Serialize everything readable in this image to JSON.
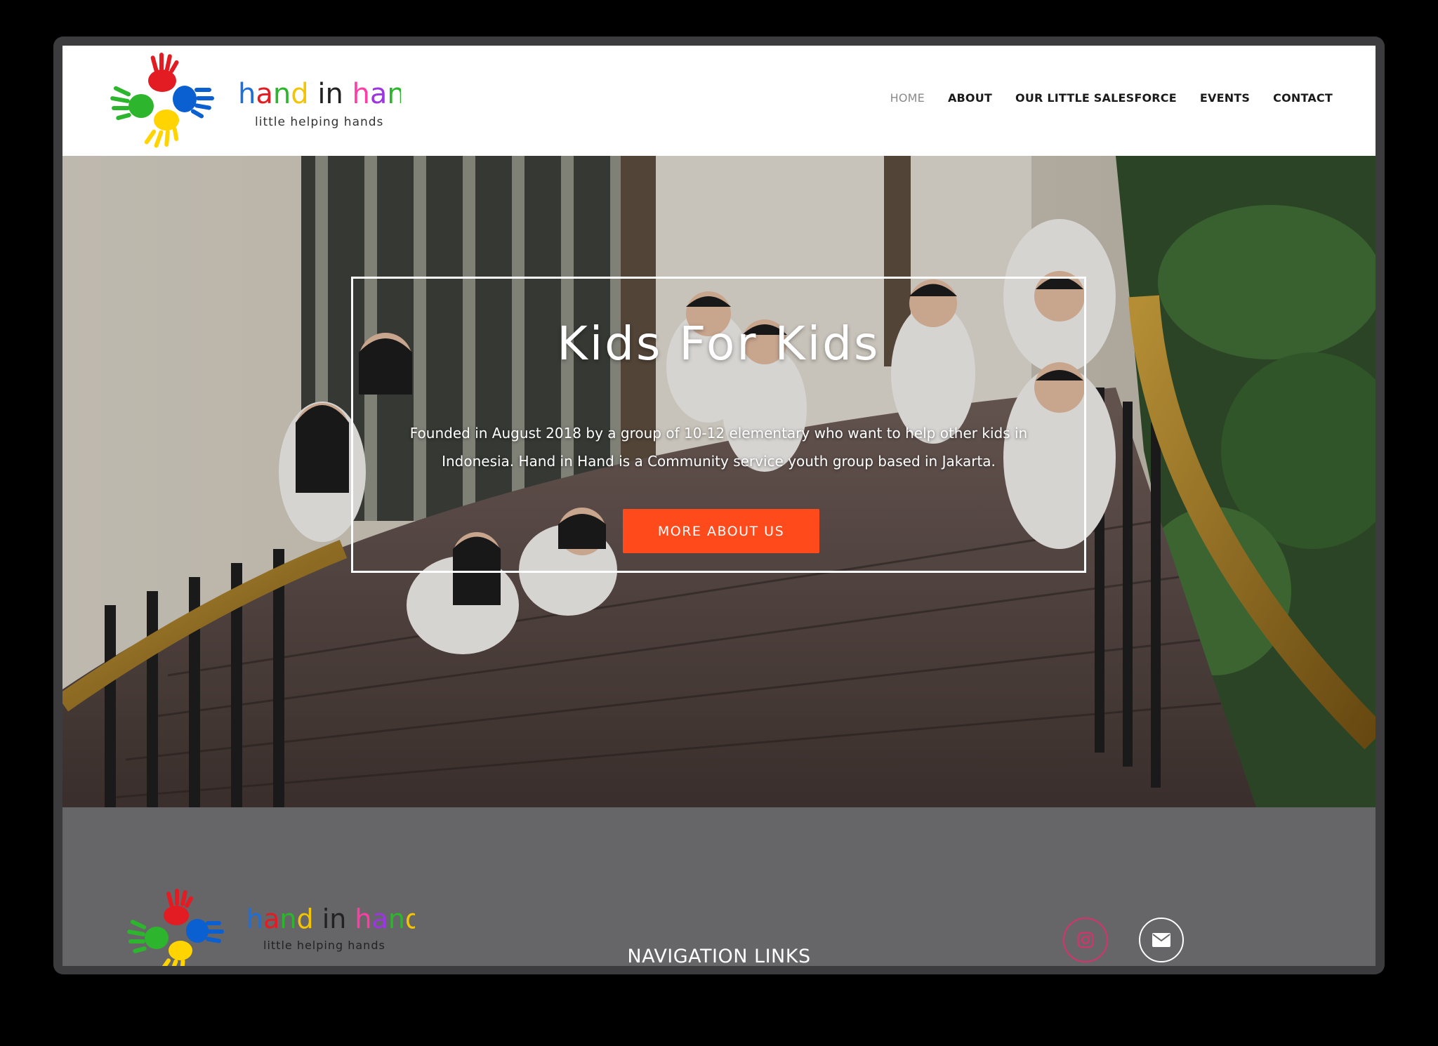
{
  "brand": {
    "name": "hand in hand",
    "tagline": "little helping hands"
  },
  "nav": {
    "items": [
      {
        "label": "HOME",
        "active": true
      },
      {
        "label": "ABOUT",
        "active": false
      },
      {
        "label": "OUR LITTLE SALESFORCE",
        "active": false
      },
      {
        "label": "EVENTS",
        "active": false
      },
      {
        "label": "CONTACT",
        "active": false
      }
    ]
  },
  "hero": {
    "title": "Kids For Kids",
    "text": "Founded in August 2018 by a group of 10-12 elementary who want to help other kids in Indonesia. Hand in Hand is a Community service youth group based in Jakarta.",
    "button_label": "MORE ABOUT US"
  },
  "footer": {
    "heading": "NAVIGATION LINKS",
    "social": [
      {
        "icon": "instagram-icon"
      },
      {
        "icon": "mail-icon"
      }
    ]
  },
  "colors": {
    "accent": "#ff4a1c",
    "footer_bg": "#666567",
    "instagram": "#d6336c"
  }
}
